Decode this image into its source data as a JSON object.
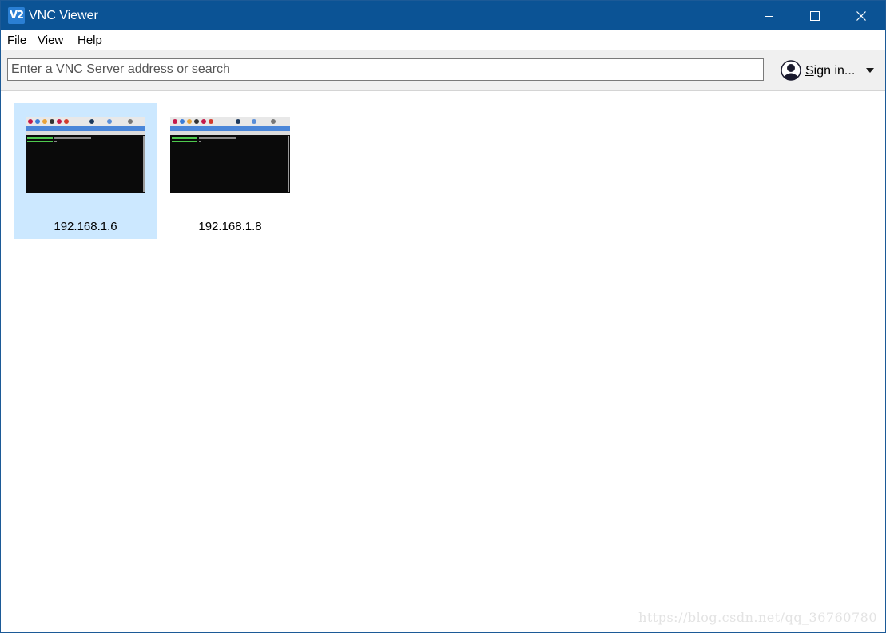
{
  "window": {
    "title": "VNC Viewer",
    "app_icon_text": "V2",
    "controls": [
      "minimize-icon",
      "maximize-icon",
      "close-icon"
    ]
  },
  "menubar": {
    "items": [
      {
        "label": "File"
      },
      {
        "label": "View"
      },
      {
        "label": "Help"
      }
    ]
  },
  "toolbar": {
    "search": {
      "placeholder": "Enter a VNC Server address or search",
      "value": ""
    },
    "signin_label": "Sign in...",
    "avatar_icon": "user-icon",
    "dropdown_icon": "caret-down-icon"
  },
  "connections": [
    {
      "label": "192.168.1.6",
      "selected": true
    },
    {
      "label": "192.168.1.8",
      "selected": false
    }
  ],
  "watermark": "https://blog.csdn.net/qq_36760780",
  "colors": {
    "titlebar": "#0b5395",
    "selection": "#cce8ff",
    "toolbar": "#f0f0f0"
  }
}
